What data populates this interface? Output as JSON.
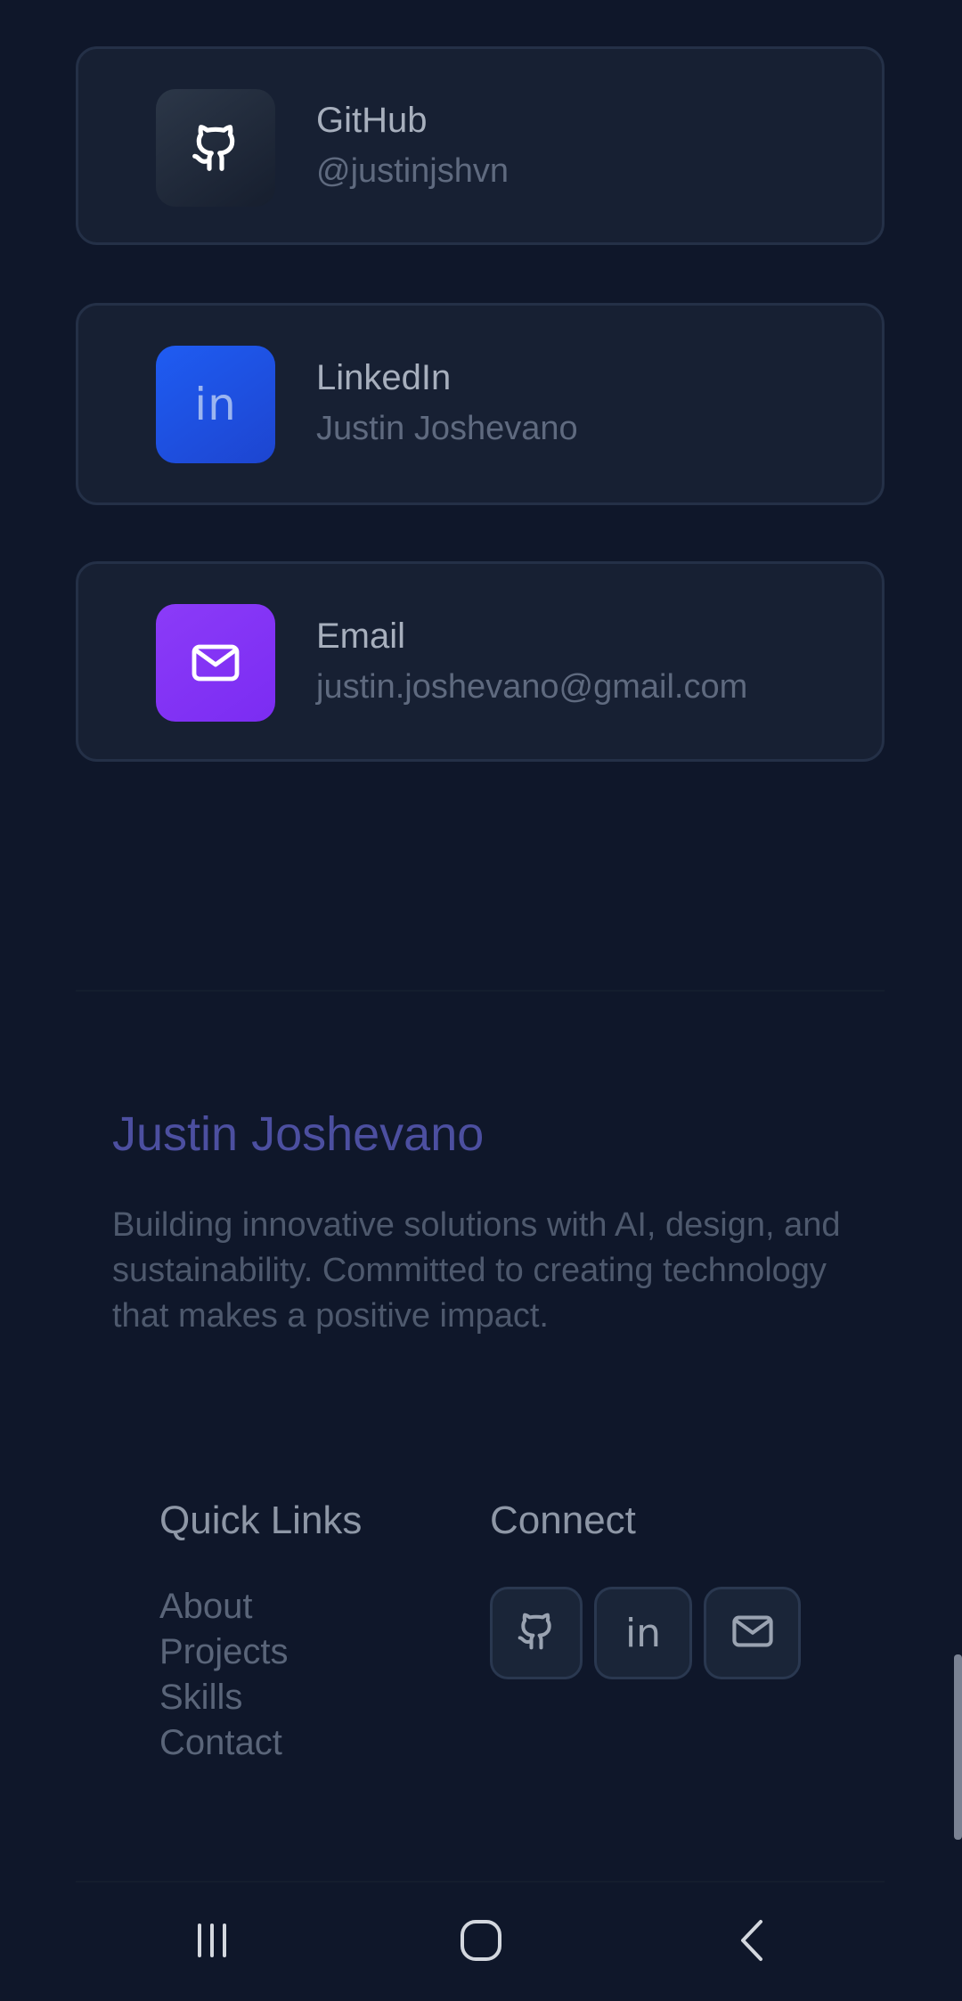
{
  "contacts": [
    {
      "title": "GitHub",
      "subtitle": "@justinjshvn",
      "icon": "github-icon",
      "color": "#1f2937"
    },
    {
      "title": "LinkedIn",
      "subtitle": "Justin Joshevano",
      "icon": "linkedin-icon",
      "color": "#1d4ed8"
    },
    {
      "title": "Email",
      "subtitle": "justin.joshevano@gmail.com",
      "icon": "email-icon",
      "color": "#7c3aed"
    }
  ],
  "footer": {
    "name": "Justin Joshevano",
    "description": "Building innovative solutions with AI, design, and sustainability. Committed to creating technology that makes a positive impact.",
    "quick_links": {
      "title": "Quick Links",
      "items": [
        "About",
        "Projects",
        "Skills",
        "Contact"
      ]
    },
    "connect": {
      "title": "Connect",
      "icons": [
        "github-icon",
        "linkedin-icon",
        "email-icon"
      ]
    }
  },
  "theme": {
    "background": "#0f172a",
    "card": "#172033",
    "accent": "#4c4fa0"
  },
  "linkedin_glyph": "in",
  "navbar": {
    "buttons": [
      "recent-apps",
      "home",
      "back"
    ]
  }
}
